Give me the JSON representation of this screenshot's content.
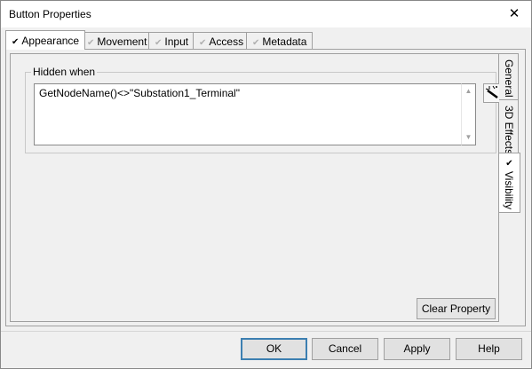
{
  "window": {
    "title": "Button Properties",
    "close_glyph": "✕"
  },
  "tabs": [
    {
      "label": "Appearance",
      "active": true
    },
    {
      "label": "Movement",
      "active": false
    },
    {
      "label": "Input",
      "active": false
    },
    {
      "label": "Access",
      "active": false
    },
    {
      "label": "Metadata",
      "active": false
    }
  ],
  "side_tabs": [
    {
      "label": "General",
      "active": false
    },
    {
      "label": "3D Effects",
      "active": false
    },
    {
      "label": "Visibility",
      "active": true
    }
  ],
  "hidden_when": {
    "label": "Hidden when",
    "expression": "GetNodeName()<>\"Substation1_Terminal\""
  },
  "clear_property_label": "Clear Property",
  "footer": {
    "ok": "OK",
    "cancel": "Cancel",
    "apply": "Apply",
    "help": "Help"
  },
  "colors": {
    "default_button_border": "#3c7fb1",
    "window_bg": "#f0f0f0"
  },
  "icons": {
    "close": "close-icon",
    "check": "check-icon",
    "wand": "magic-wand-icon"
  }
}
